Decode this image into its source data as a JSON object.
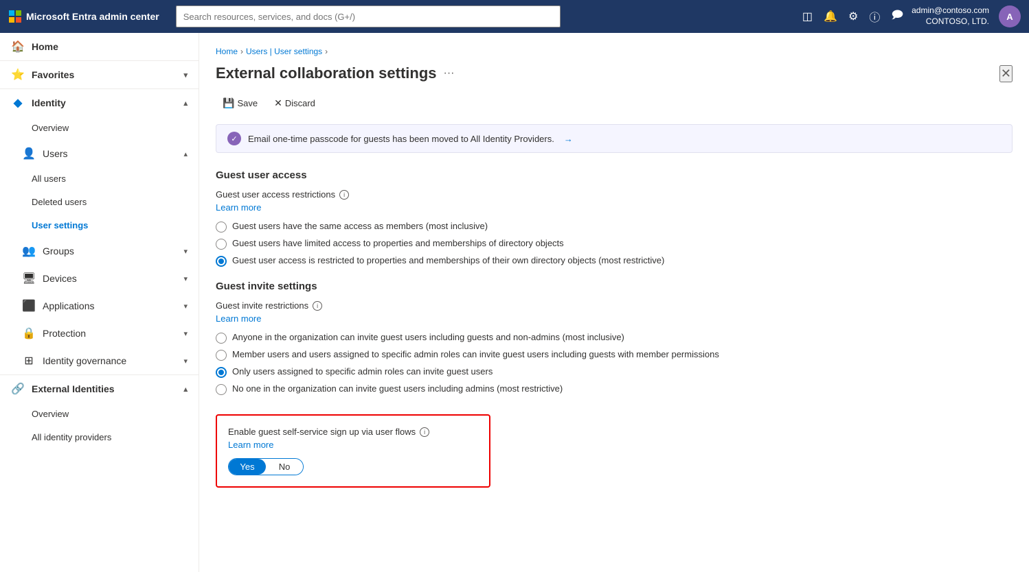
{
  "topbar": {
    "brand": "Microsoft Entra admin center",
    "search_placeholder": "Search resources, services, and docs (G+/)",
    "user_name": "admin@contoso.com",
    "user_org": "CONTOSO, LTD.",
    "avatar_initials": "A"
  },
  "sidebar": {
    "home_label": "Home",
    "favorites_label": "Favorites",
    "identity_label": "Identity",
    "identity_subitems": [
      {
        "label": "Overview"
      },
      {
        "label": "Users",
        "expanded": true
      },
      {
        "label": "All users"
      },
      {
        "label": "Deleted users"
      },
      {
        "label": "User settings",
        "active": true
      },
      {
        "label": "Groups"
      },
      {
        "label": "Devices"
      },
      {
        "label": "Applications"
      },
      {
        "label": "Protection"
      },
      {
        "label": "Identity governance"
      }
    ],
    "external_identities_label": "External Identities",
    "external_subitems": [
      {
        "label": "Overview"
      },
      {
        "label": "All identity providers"
      }
    ]
  },
  "breadcrumb": {
    "home": "Home",
    "parent": "Users | User settings",
    "current": ""
  },
  "page": {
    "title": "External collaboration settings",
    "save_label": "Save",
    "discard_label": "Discard",
    "info_banner": "Email one-time passcode for guests has been moved to All Identity Providers.",
    "info_banner_link": "→",
    "guest_access_title": "Guest user access",
    "guest_access_restrictions_label": "Guest user access restrictions",
    "learn_more_1": "Learn more",
    "guest_access_options": [
      "Guest users have the same access as members (most inclusive)",
      "Guest users have limited access to properties and memberships of directory objects",
      "Guest user access is restricted to properties and memberships of their own directory objects (most restrictive)"
    ],
    "guest_access_selected": 2,
    "guest_invite_title": "Guest invite settings",
    "guest_invite_restrictions_label": "Guest invite restrictions",
    "learn_more_2": "Learn more",
    "guest_invite_options": [
      "Anyone in the organization can invite guest users including guests and non-admins (most inclusive)",
      "Member users and users assigned to specific admin roles can invite guest users including guests with member permissions",
      "Only users assigned to specific admin roles can invite guest users",
      "No one in the organization can invite guest users including admins (most restrictive)"
    ],
    "guest_invite_selected": 2,
    "self_service_label": "Enable guest self-service sign up via user flows",
    "learn_more_3": "Learn more",
    "toggle_yes": "Yes",
    "toggle_no": "No",
    "toggle_selected": "yes"
  }
}
